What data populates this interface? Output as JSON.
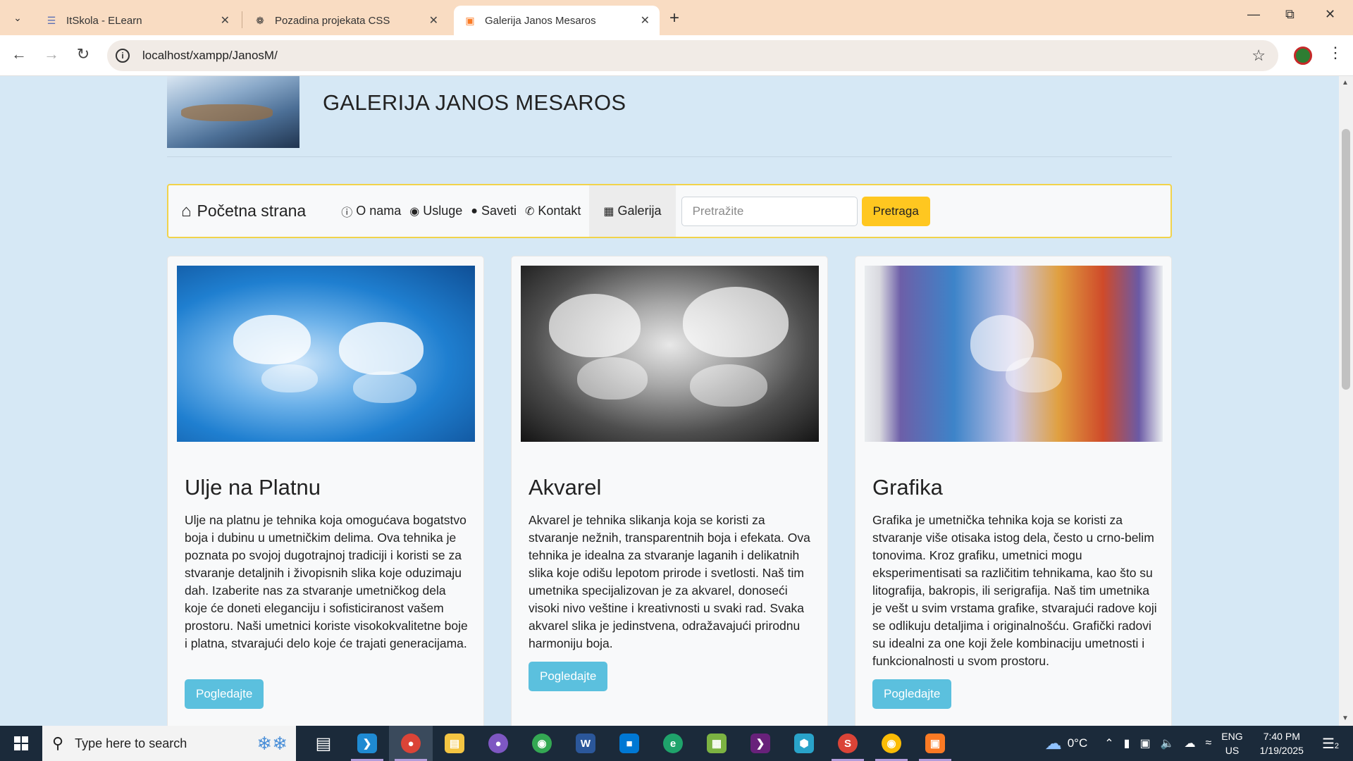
{
  "browser": {
    "tabs": [
      {
        "title": "ItSkola - ELearn",
        "icon": "stack-icon"
      },
      {
        "title": "Pozadina projekata CSS",
        "icon": "openai-icon"
      },
      {
        "title": "Galerija Janos Mesaros",
        "icon": "xampp-icon"
      }
    ],
    "url": "localhost/xampp/JanosM/"
  },
  "site": {
    "title": "GALERIJA JANOS MESAROS"
  },
  "nav": {
    "brand": "Početna strana",
    "links": [
      {
        "label": "O nama",
        "icon": "info-icon"
      },
      {
        "label": "Usluge",
        "icon": "palette-icon"
      },
      {
        "label": "Saveti",
        "icon": "lightbulb-icon"
      },
      {
        "label": "Kontakt",
        "icon": "phone-icon"
      },
      {
        "label": "Galerija",
        "icon": "image-icon"
      }
    ],
    "search_placeholder": "Pretražite",
    "search_button": "Pretraga"
  },
  "cards": [
    {
      "title": "Ulje na Platnu",
      "text": "Ulje na platnu je tehnika koja omogućava bogatstvo boja i dubinu u umetničkim delima. Ova tehnika je poznata po svojoj dugotrajnoj tradiciji i koristi se za stvaranje detaljnih i živopisnih slika koje oduzimaju dah. Izaberite nas za stvaranje umetničkog dela koje će doneti eleganciju i sofisticiranost vašem prostoru. Naši umetnici koriste visokokvalitetne boje i platna, stvarajući delo koje će trajati generacijama.",
      "button": "Pogledajte"
    },
    {
      "title": "Akvarel",
      "text": "Akvarel je tehnika slikanja koja se koristi za stvaranje nežnih, transparentnih boja i efekata. Ova tehnika je idealna za stvaranje laganih i delikatnih slika koje odišu lepotom prirode i svetlosti. Naš tim umetnika specijalizovan je za akvarel, donoseći visoki nivo veštine i kreativnosti u svaki rad. Svaka akvarel slika je jedinstvena, odražavajući prirodnu harmoniju boja.",
      "button": "Pogledajte"
    },
    {
      "title": "Grafika",
      "text": "Grafika je umetnička tehnika koja se koristi za stvaranje više otisaka istog dela, često u crno-belim tonovima. Kroz grafiku, umetnici mogu eksperimentisati sa različitim tehnikama, kao što su litografija, bakropis, ili serigrafija. Naš tim umetnika je vešt u svim vrstama grafike, stvarajući radove koji se odlikuju detaljima i originalnošću. Grafički radovi su idealni za one koji žele kombinaciju umetnosti i funkcionalnosti u svom prostoru.",
      "button": "Pogledajte"
    }
  ],
  "taskbar": {
    "search_placeholder": "Type here to search",
    "weather": "0°C",
    "lang": "ENG",
    "region": "US",
    "time": "7:40 PM",
    "date": "1/19/2025",
    "notifications": "2"
  }
}
